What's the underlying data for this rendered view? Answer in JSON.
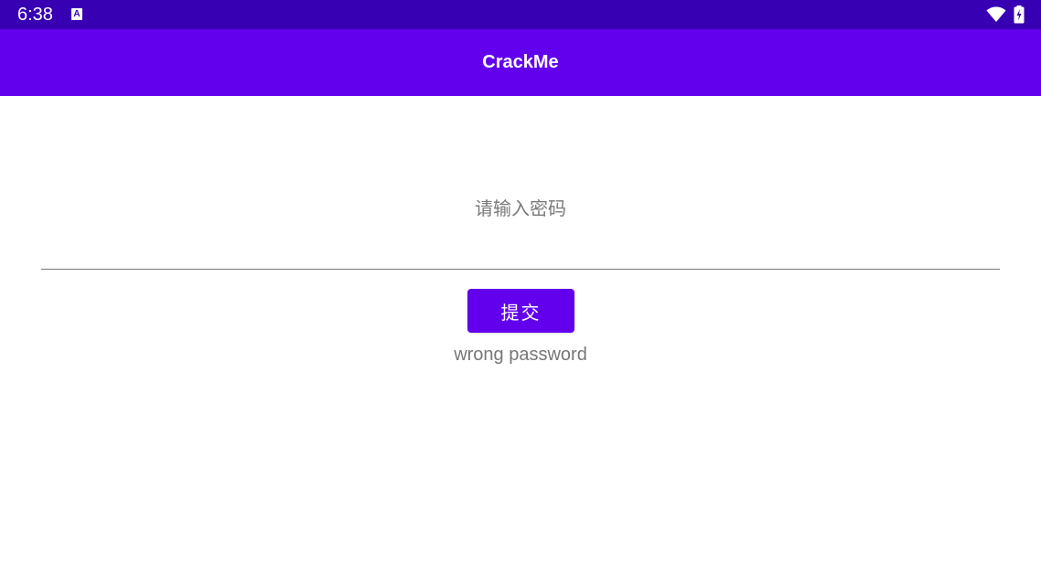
{
  "status_bar": {
    "time": "6:38",
    "color": "#3700b3",
    "icons": [
      "a-notification-icon",
      "wifi-icon",
      "battery-charging-icon"
    ]
  },
  "app_bar": {
    "title": "CrackMe",
    "color": "#6200ee"
  },
  "form": {
    "password_value": "",
    "password_placeholder": "请输入密码",
    "submit_label": "提交",
    "result_message": "wrong password"
  }
}
